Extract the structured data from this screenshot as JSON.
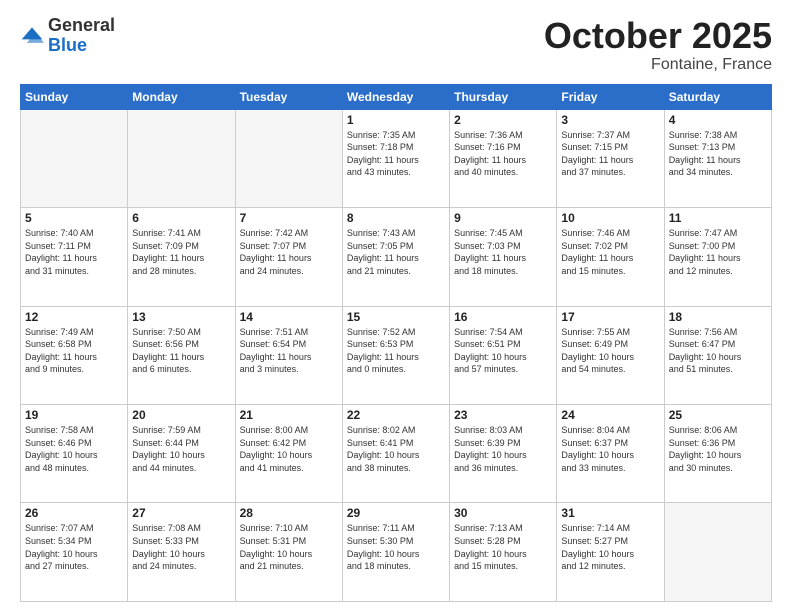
{
  "logo": {
    "general": "General",
    "blue": "Blue"
  },
  "header": {
    "month": "October 2025",
    "location": "Fontaine, France"
  },
  "days_of_week": [
    "Sunday",
    "Monday",
    "Tuesday",
    "Wednesday",
    "Thursday",
    "Friday",
    "Saturday"
  ],
  "weeks": [
    [
      {
        "day": "",
        "info": ""
      },
      {
        "day": "",
        "info": ""
      },
      {
        "day": "",
        "info": ""
      },
      {
        "day": "1",
        "info": "Sunrise: 7:35 AM\nSunset: 7:18 PM\nDaylight: 11 hours\nand 43 minutes."
      },
      {
        "day": "2",
        "info": "Sunrise: 7:36 AM\nSunset: 7:16 PM\nDaylight: 11 hours\nand 40 minutes."
      },
      {
        "day": "3",
        "info": "Sunrise: 7:37 AM\nSunset: 7:15 PM\nDaylight: 11 hours\nand 37 minutes."
      },
      {
        "day": "4",
        "info": "Sunrise: 7:38 AM\nSunset: 7:13 PM\nDaylight: 11 hours\nand 34 minutes."
      }
    ],
    [
      {
        "day": "5",
        "info": "Sunrise: 7:40 AM\nSunset: 7:11 PM\nDaylight: 11 hours\nand 31 minutes."
      },
      {
        "day": "6",
        "info": "Sunrise: 7:41 AM\nSunset: 7:09 PM\nDaylight: 11 hours\nand 28 minutes."
      },
      {
        "day": "7",
        "info": "Sunrise: 7:42 AM\nSunset: 7:07 PM\nDaylight: 11 hours\nand 24 minutes."
      },
      {
        "day": "8",
        "info": "Sunrise: 7:43 AM\nSunset: 7:05 PM\nDaylight: 11 hours\nand 21 minutes."
      },
      {
        "day": "9",
        "info": "Sunrise: 7:45 AM\nSunset: 7:03 PM\nDaylight: 11 hours\nand 18 minutes."
      },
      {
        "day": "10",
        "info": "Sunrise: 7:46 AM\nSunset: 7:02 PM\nDaylight: 11 hours\nand 15 minutes."
      },
      {
        "day": "11",
        "info": "Sunrise: 7:47 AM\nSunset: 7:00 PM\nDaylight: 11 hours\nand 12 minutes."
      }
    ],
    [
      {
        "day": "12",
        "info": "Sunrise: 7:49 AM\nSunset: 6:58 PM\nDaylight: 11 hours\nand 9 minutes."
      },
      {
        "day": "13",
        "info": "Sunrise: 7:50 AM\nSunset: 6:56 PM\nDaylight: 11 hours\nand 6 minutes."
      },
      {
        "day": "14",
        "info": "Sunrise: 7:51 AM\nSunset: 6:54 PM\nDaylight: 11 hours\nand 3 minutes."
      },
      {
        "day": "15",
        "info": "Sunrise: 7:52 AM\nSunset: 6:53 PM\nDaylight: 11 hours\nand 0 minutes."
      },
      {
        "day": "16",
        "info": "Sunrise: 7:54 AM\nSunset: 6:51 PM\nDaylight: 10 hours\nand 57 minutes."
      },
      {
        "day": "17",
        "info": "Sunrise: 7:55 AM\nSunset: 6:49 PM\nDaylight: 10 hours\nand 54 minutes."
      },
      {
        "day": "18",
        "info": "Sunrise: 7:56 AM\nSunset: 6:47 PM\nDaylight: 10 hours\nand 51 minutes."
      }
    ],
    [
      {
        "day": "19",
        "info": "Sunrise: 7:58 AM\nSunset: 6:46 PM\nDaylight: 10 hours\nand 48 minutes."
      },
      {
        "day": "20",
        "info": "Sunrise: 7:59 AM\nSunset: 6:44 PM\nDaylight: 10 hours\nand 44 minutes."
      },
      {
        "day": "21",
        "info": "Sunrise: 8:00 AM\nSunset: 6:42 PM\nDaylight: 10 hours\nand 41 minutes."
      },
      {
        "day": "22",
        "info": "Sunrise: 8:02 AM\nSunset: 6:41 PM\nDaylight: 10 hours\nand 38 minutes."
      },
      {
        "day": "23",
        "info": "Sunrise: 8:03 AM\nSunset: 6:39 PM\nDaylight: 10 hours\nand 36 minutes."
      },
      {
        "day": "24",
        "info": "Sunrise: 8:04 AM\nSunset: 6:37 PM\nDaylight: 10 hours\nand 33 minutes."
      },
      {
        "day": "25",
        "info": "Sunrise: 8:06 AM\nSunset: 6:36 PM\nDaylight: 10 hours\nand 30 minutes."
      }
    ],
    [
      {
        "day": "26",
        "info": "Sunrise: 7:07 AM\nSunset: 5:34 PM\nDaylight: 10 hours\nand 27 minutes."
      },
      {
        "day": "27",
        "info": "Sunrise: 7:08 AM\nSunset: 5:33 PM\nDaylight: 10 hours\nand 24 minutes."
      },
      {
        "day": "28",
        "info": "Sunrise: 7:10 AM\nSunset: 5:31 PM\nDaylight: 10 hours\nand 21 minutes."
      },
      {
        "day": "29",
        "info": "Sunrise: 7:11 AM\nSunset: 5:30 PM\nDaylight: 10 hours\nand 18 minutes."
      },
      {
        "day": "30",
        "info": "Sunrise: 7:13 AM\nSunset: 5:28 PM\nDaylight: 10 hours\nand 15 minutes."
      },
      {
        "day": "31",
        "info": "Sunrise: 7:14 AM\nSunset: 5:27 PM\nDaylight: 10 hours\nand 12 minutes."
      },
      {
        "day": "",
        "info": ""
      }
    ]
  ]
}
